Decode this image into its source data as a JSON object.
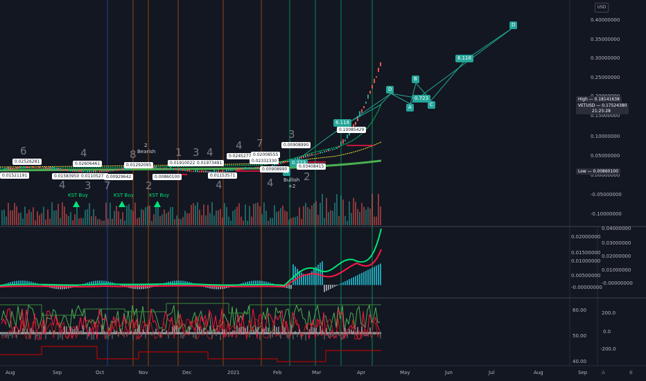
{
  "currency_button": "USD",
  "price_axis": [
    "0.40000000",
    "0.35000000",
    "0.30000000",
    "0.25000000",
    "0.20000000",
    "0.15000000",
    "0.10000000",
    "0.05000000",
    "0.00000000",
    "-0.05000000",
    "-0.10000000"
  ],
  "high": {
    "label": "High",
    "value": "0.18141638"
  },
  "last": {
    "symbol": "VETUSD",
    "value": "0.17524380",
    "time": "21:25:28"
  },
  "low": {
    "label": "Low",
    "value": "0.00860100"
  },
  "macd_axis_left": [
    "0.02000000",
    "0.01500000",
    "0.01000000",
    "0.00500000",
    "-0.00000000"
  ],
  "macd_axis_right": [
    "0.04000000",
    "0.03000000",
    "0.02000000",
    "0.01000000",
    "-0.00000000"
  ],
  "osc_axis_left": [
    "60.00",
    "50.00",
    "40.00"
  ],
  "osc_axis_right": [
    "200.0",
    "0.0",
    "-200.0"
  ],
  "time_axis": [
    "Aug",
    "Sep",
    "Oct",
    "Nov",
    "Dec",
    "2021",
    "Feb",
    "Mar",
    "Apr",
    "May",
    "Jun",
    "Jul",
    "Aug",
    "Sep"
  ],
  "corner_buttons": [
    "A",
    "B"
  ],
  "elliott": [
    "D",
    "A",
    "B",
    "C",
    "D"
  ],
  "fib_labels": [
    "6.118",
    "0.723",
    "6.118",
    "0.723"
  ],
  "kst": [
    "KST Buy",
    "KST Buy",
    "KST Buy"
  ],
  "bearish": {
    "num": "2",
    "text": "Bearish"
  },
  "bullish": {
    "text": "Bullish",
    "num": "+2"
  },
  "wave_letters": [
    "A",
    "2"
  ],
  "price_pills": [
    "0.02526281",
    "0.01521191",
    "0.01583950",
    "0.01105275",
    "0.00929642",
    "0.02606461",
    "0.01292095",
    "0.00860100",
    "0.01910022",
    "0.01153571",
    "0.01973491",
    "0.02452772",
    "0.02008555",
    "0.02332330",
    "0.00908990",
    "0.10085429",
    "0.03408415"
  ],
  "count_numbers": [
    "6",
    "4",
    "4",
    "3",
    "7",
    "8",
    "2",
    "1",
    "3",
    "4",
    "4",
    "4",
    "7",
    "3",
    "4"
  ]
}
